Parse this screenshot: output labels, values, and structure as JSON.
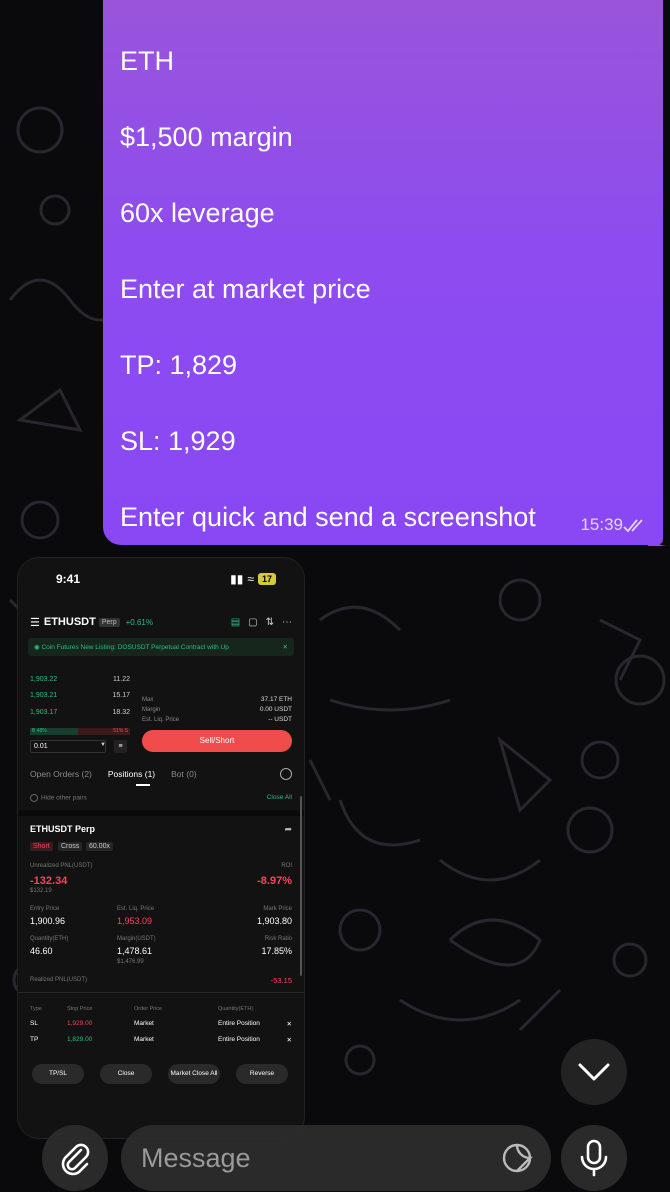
{
  "message": {
    "lines": [
      "ETH",
      "$1,500 margin",
      "60x leverage",
      "Enter at market price",
      "TP: 1,829",
      "SL: 1,929",
      "Enter quick and send a screenshot"
    ],
    "time": "15:39",
    "bubble_color": "#8a48f5"
  },
  "screenshot": {
    "status_time": "9:41",
    "battery": "17",
    "pair": "ETHUSDT",
    "pair_tag": "Perp",
    "change": "+0.61%",
    "notice": "Coin Futures New Listing: DOSUSDT Perpetual Contract with Up",
    "orderbook": [
      {
        "price": "1,903.22",
        "qty": "11.22"
      },
      {
        "price": "1,903.21",
        "qty": "15.17"
      },
      {
        "price": "1,903.17",
        "qty": "18.32"
      }
    ],
    "buy_ratio": "B 48%",
    "sell_ratio": "51% S",
    "qty_value": "0.01",
    "max_label": "Max",
    "max_value": "37.17 ETH",
    "margin_label": "Margin",
    "margin_value": "0.00 USDT",
    "liq_label": "Est. Liq. Price",
    "liq_value": "-- USDT",
    "sell_button": "Sell/Short",
    "tabs": [
      "Open Orders (2)",
      "Positions (1)",
      "Bot (0)"
    ],
    "hide_pairs": "Hide other pairs",
    "close_all": "Close All",
    "position": {
      "title": "ETHUSDT Perp",
      "side": "Short",
      "mode": "Cross",
      "leverage": "60.00x",
      "pnl_label": "Unrealized PNL(USDT)",
      "pnl_value": "-132.34",
      "pnl_sub": "$132.19",
      "roi_label": "ROI",
      "roi_value": "-8.97%",
      "entry_label": "Entry Price",
      "entry_value": "1,900.96",
      "liq_label": "Est. Liq. Price",
      "liq_value": "1,953.09",
      "mark_label": "Mark Price",
      "mark_value": "1,903.80",
      "qty_label": "Quantity(ETH)",
      "qty_value": "46.60",
      "margin_label": "Margin(USDT)",
      "margin_value": "1,478.61",
      "margin_sub": "$1,476.99",
      "risk_label": "Risk Ratio",
      "risk_value": "17.85%",
      "realized_label": "Realized PNL(USDT)",
      "realized_value": "-53.15"
    },
    "tpsl_headers": [
      "Type",
      "Stop Price",
      "Order Price",
      "Quantity(ETH)"
    ],
    "tpsl_rows": [
      {
        "type": "SL",
        "stop": "1,929.00",
        "order": "Market",
        "qty": "Entire Position"
      },
      {
        "type": "TP",
        "stop": "1,829.00",
        "order": "Market",
        "qty": "Entire Position"
      }
    ],
    "buttons": [
      "TP/SL",
      "Close",
      "Market Close All",
      "Reverse"
    ]
  },
  "composer": {
    "placeholder": "Message"
  }
}
